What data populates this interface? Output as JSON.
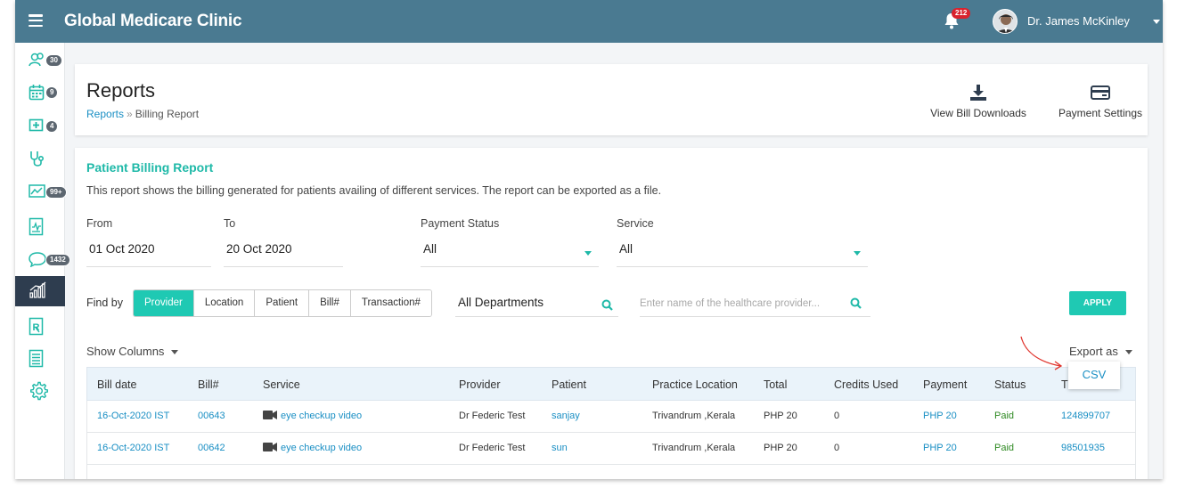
{
  "app": {
    "title": "Global Medicare Clinic",
    "notification_count": "212",
    "user_name": "Dr. James McKinley"
  },
  "sidebar": {
    "items": [
      {
        "icon": "users-icon",
        "badge": "30"
      },
      {
        "icon": "calendar-icon",
        "badge": "9"
      },
      {
        "icon": "medical-plus-icon",
        "badge": "4"
      },
      {
        "icon": "stethoscope-icon",
        "badge": ""
      },
      {
        "icon": "trend-chart-icon",
        "badge": "99+"
      },
      {
        "icon": "health-report-icon",
        "badge": ""
      },
      {
        "icon": "chat-icon",
        "badge": "1432"
      },
      {
        "icon": "bar-chart-icon",
        "badge": "",
        "active": true
      },
      {
        "icon": "prescription-icon",
        "badge": ""
      },
      {
        "icon": "billing-list-icon",
        "badge": ""
      },
      {
        "icon": "gear-icon",
        "badge": ""
      }
    ]
  },
  "header": {
    "page_title": "Reports",
    "breadcrumb_link": "Reports",
    "breadcrumb_sep": "»",
    "breadcrumb_current": "Billing Report",
    "view_bill_downloads": "View Bill Downloads",
    "payment_settings": "Payment Settings"
  },
  "report": {
    "title": "Patient Billing Report",
    "description": "This report shows the billing generated for patients availing of different services. The report can be exported as a file.",
    "filters": {
      "from_label": "From",
      "from_value": "01 Oct 2020",
      "to_label": "To",
      "to_value": "20 Oct 2020",
      "payment_status_label": "Payment Status",
      "payment_status_value": "All",
      "service_label": "Service",
      "service_value": "All"
    },
    "find_by": {
      "label": "Find by",
      "options": [
        "Provider",
        "Location",
        "Patient",
        "Bill#",
        "Transaction#"
      ],
      "selected": "Provider",
      "department": "All Departments",
      "provider_placeholder": "Enter name of the healthcare provider...",
      "apply_label": "APPLY"
    },
    "show_columns_label": "Show Columns",
    "export_label": "Export as",
    "export_options": [
      "CSV"
    ]
  },
  "table": {
    "headers": [
      "Bill date",
      "Bill#",
      "Service",
      "Provider",
      "Patient",
      "Practice Location",
      "Total",
      "Credits Used",
      "Payment",
      "Status",
      "Tr"
    ],
    "rows": [
      {
        "bill_date": "16-Oct-2020 IST",
        "bill_no": "00643",
        "service": "eye checkup video",
        "provider": "Dr Federic Test",
        "patient": "sanjay",
        "location": "Trivandrum ,Kerala",
        "total": "PHP 20",
        "credits": "0",
        "payment": "PHP 20",
        "status": "Paid",
        "transaction": "124899707"
      },
      {
        "bill_date": "16-Oct-2020 IST",
        "bill_no": "00642",
        "service": "eye checkup video",
        "provider": "Dr Federic Test",
        "patient": "sun",
        "location": "Trivandrum ,Kerala",
        "total": "PHP 20",
        "credits": "0",
        "payment": "PHP 20",
        "status": "Paid",
        "transaction": "98501935"
      }
    ]
  },
  "colors": {
    "topbar": "#4a7a91",
    "accent": "#1fc9b3",
    "link": "#1a8fc4",
    "paid": "#2f8a23",
    "badge_red": "#d9232e",
    "sidebar_active": "#2e3d4f"
  }
}
